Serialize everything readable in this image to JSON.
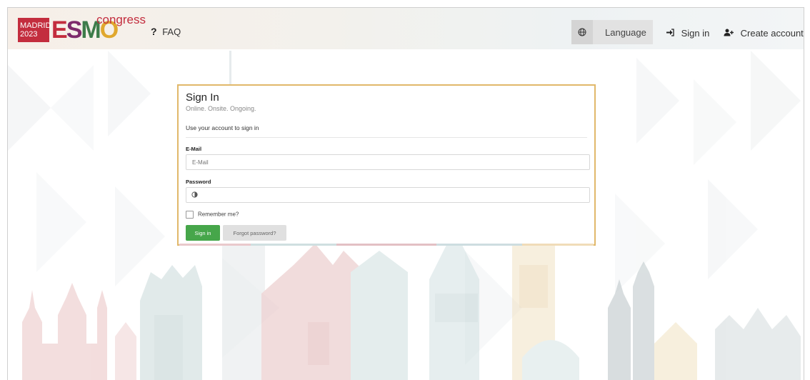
{
  "colors": {
    "brand_red": "#c32d3e",
    "accent_gold": "#e1b86a",
    "primary_button": "#46a64a",
    "secondary_button": "#e0e0e0"
  },
  "header": {
    "logo": {
      "city": "MADRID",
      "year": "2023",
      "brand_letters": [
        "E",
        "S",
        "M",
        "O"
      ],
      "suffix": "congress"
    },
    "faq_label": "FAQ",
    "language": {
      "label": "Language",
      "icon": "globe-icon"
    },
    "sign_in_label": "Sign in",
    "sign_in_icon": "sign-in-arrow-icon",
    "create_account_label": "Create account",
    "create_account_icon": "user-plus-icon"
  },
  "form": {
    "title": "Sign In",
    "subtitle": "Online. Onsite. Ongoing.",
    "hint": "Use your account to sign in",
    "email_label": "E-Mail",
    "email_placeholder": "E-Mail",
    "email_value": "",
    "password_label": "Password",
    "password_value": "",
    "remember_label": "Remember me?",
    "remember_checked": false,
    "submit_label": "Sign in",
    "forgot_label": "Forgot password?"
  }
}
